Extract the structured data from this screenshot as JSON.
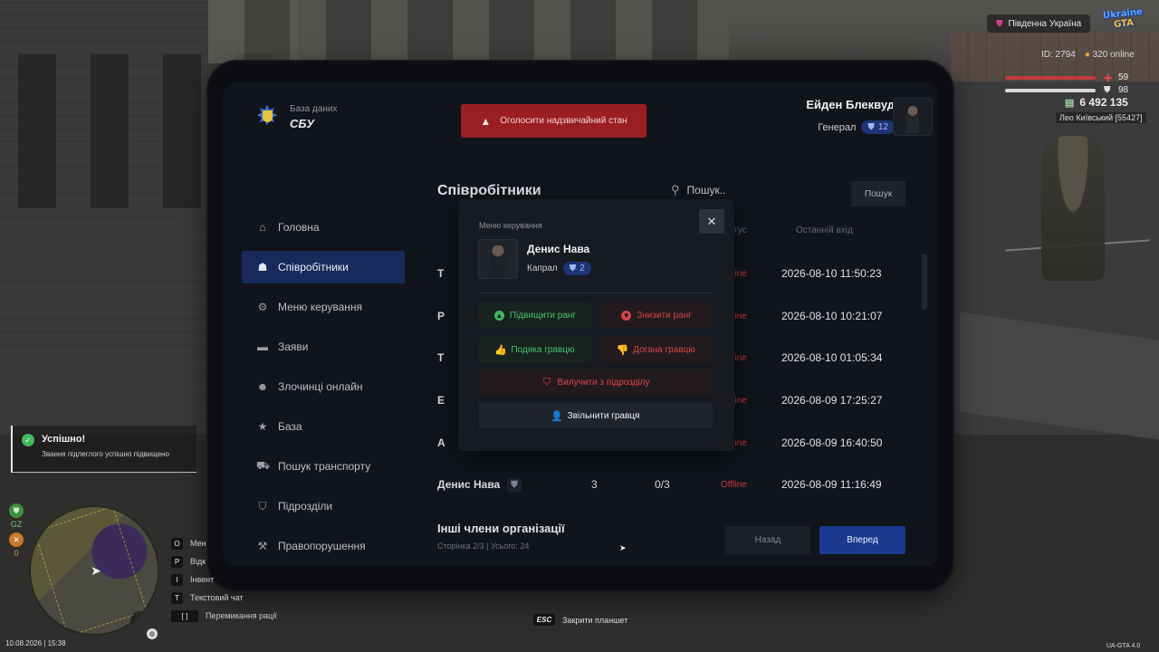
{
  "hud": {
    "region": "Південна Україна",
    "logo_line1": "Ukraine",
    "logo_line2": "GTA",
    "player_id": "ID: 2794",
    "online": "320 online",
    "health": "59",
    "armor": "98",
    "money": "6 492 135",
    "nickname": "Лео Київський [55427]"
  },
  "tablet": {
    "org_caption": "База даних",
    "org_name": "СБУ",
    "emergency_label": "Оголосити надзвичайний стан",
    "profile": {
      "name": "Ейден Блеквуд",
      "rank": "Генерал",
      "rank_level": "12"
    },
    "sidebar": [
      {
        "label": "Головна",
        "icon": "home-icon",
        "glyph": "⌂",
        "active": false
      },
      {
        "label": "Співробітники",
        "icon": "users-icon",
        "glyph": "👥",
        "active": true
      },
      {
        "label": "Меню керування",
        "icon": "gear-icon",
        "glyph": "⚙",
        "active": false
      },
      {
        "label": "Заяви",
        "icon": "folder-icon",
        "glyph": "▬",
        "active": false
      },
      {
        "label": "Злочинці онлайн",
        "icon": "mask-icon",
        "glyph": "☻",
        "active": false
      },
      {
        "label": "База",
        "icon": "star-icon",
        "glyph": "★",
        "active": false
      },
      {
        "label": "Пошук транспорту",
        "icon": "car-icon",
        "glyph": "⛟",
        "active": false
      },
      {
        "label": "Підрозділи",
        "icon": "shield-icon",
        "glyph": "⛉",
        "active": false
      },
      {
        "label": "Правопорушення",
        "icon": "gavel-icon",
        "glyph": "⚒",
        "active": false
      }
    ],
    "section_title": "Співробітники",
    "search_placeholder": "Пошук..",
    "search_button": "Пошук",
    "columns": {
      "status": "Статус",
      "last_login": "Останній вхід"
    },
    "rows": [
      {
        "name": "Т",
        "rank": "",
        "warns": "",
        "status": "Offline",
        "time": "2026-08-10 11:50:23"
      },
      {
        "name": "Р",
        "rank": "",
        "warns": "",
        "status": "Offline",
        "time": "2026-08-10 10:21:07"
      },
      {
        "name": "Т",
        "rank": "",
        "warns": "",
        "status": "Offline",
        "time": "2026-08-10 01:05:34"
      },
      {
        "name": "Е",
        "rank": "",
        "warns": "",
        "status": "Offline",
        "time": "2026-08-09 17:25:27"
      },
      {
        "name": "А",
        "rank": "",
        "warns": "",
        "status": "Offline",
        "time": "2026-08-09 16:40:50"
      },
      {
        "name": "Денис Нава",
        "rank": "3",
        "warns": "0/3",
        "status": "Offline",
        "time": "2026-08-09 11:16:49"
      }
    ],
    "other_title": "Інші члени організації",
    "page_info": "Сторінка 2/3 | Усього: 24",
    "prev_button": "Назад",
    "next_button": "Вперед"
  },
  "modal": {
    "caption": "Меню керування",
    "close": "✕",
    "member_name": "Денис Нава",
    "member_rank": "Капрал",
    "member_rank_level": "2",
    "promote": "Підвищити ранг",
    "demote": "Знизити ранг",
    "thank": "Подяка гравцю",
    "reprimand": "Догана гравцю",
    "exclude": "Вилучити з підрозділу",
    "fire": "Звільнити гравця"
  },
  "notification": {
    "title": "Успішно!",
    "text": "Звання підлеглого успішно підвищено"
  },
  "bottom_hud": {
    "gz_label": "GZ",
    "gz_count": "0",
    "keys": [
      {
        "key": "O",
        "label": "Мен"
      },
      {
        "key": "P",
        "label": "Відк"
      },
      {
        "key": "I",
        "label": "Інвент"
      },
      {
        "key": "T",
        "label": "Текстовий чат"
      },
      {
        "key": "[ ]",
        "label": "Перемикання рації"
      }
    ],
    "esc_key": "ESC",
    "esc_label": "Закрити планшет",
    "datetime": "10.08.2026 | 15:38",
    "version": "UA-GTA 4.0"
  }
}
